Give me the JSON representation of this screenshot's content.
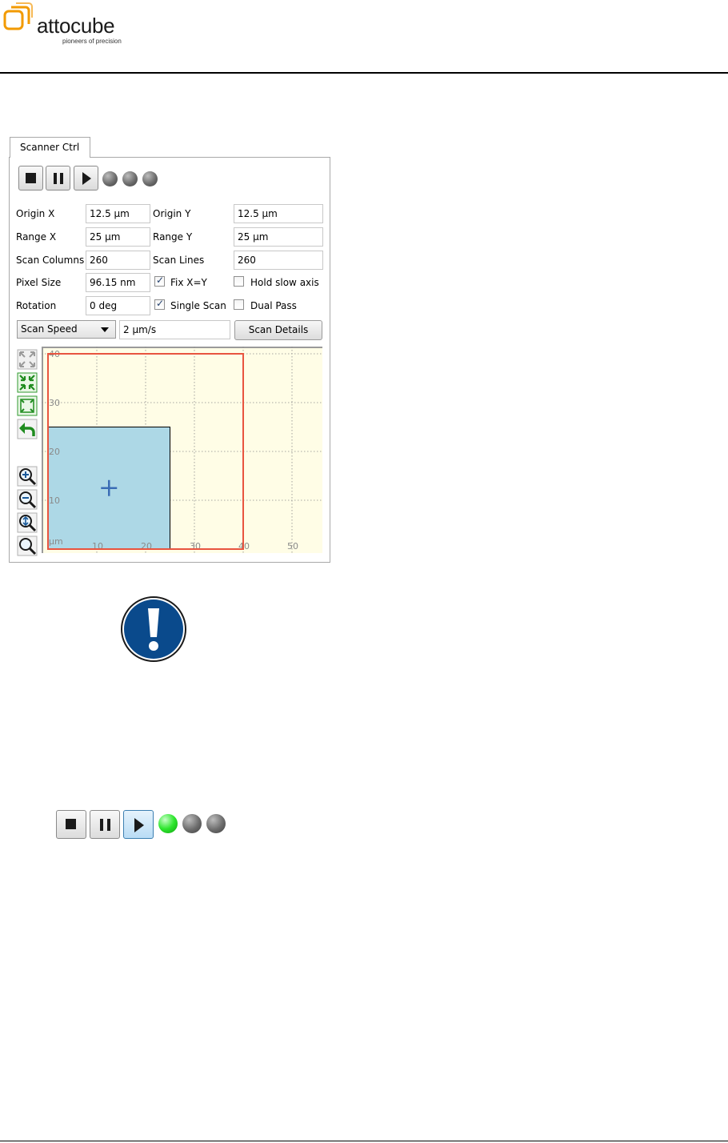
{
  "header": {
    "brand": "attocube",
    "tagline": "pioneers of precision",
    "brand_color": "#f29a00"
  },
  "scanner_ctrl": {
    "tab_label": "Scanner Ctrl",
    "toolbar": {
      "buttons": [
        "stop",
        "pause",
        "play"
      ],
      "indicators": [
        "off",
        "off",
        "off"
      ]
    },
    "fields": {
      "origin_x": {
        "label": "Origin X",
        "value": "12.5 µm"
      },
      "origin_y": {
        "label": "Origin Y",
        "value": "12.5 µm"
      },
      "range_x": {
        "label": "Range X",
        "value": "25 µm"
      },
      "range_y": {
        "label": "Range Y",
        "value": "25 µm"
      },
      "scan_columns": {
        "label": "Scan Columns",
        "value": "260"
      },
      "scan_lines": {
        "label": "Scan Lines",
        "value": "260"
      },
      "pixel_size": {
        "label": "Pixel Size",
        "value": "96.15 nm"
      },
      "rotation": {
        "label": "Rotation",
        "value": "0 deg"
      }
    },
    "checkboxes": {
      "fix_xy": {
        "label": "Fix  X=Y",
        "checked": true
      },
      "hold_slow_axis": {
        "label": "Hold slow axis",
        "checked": false
      },
      "single_scan": {
        "label": "Single Scan",
        "checked": true
      },
      "dual_pass": {
        "label": "Dual Pass",
        "checked": false
      }
    },
    "speed_select": {
      "selected": "Scan Speed",
      "value": "2 µm/s"
    },
    "scan_details_label": "Scan Details",
    "side_tools": [
      "fit-all-icon",
      "shrink-icon",
      "expand-icon",
      "undo-icon",
      "zoom-in-icon",
      "zoom-out-icon",
      "zoom-fit-icon",
      "zoom-icon"
    ]
  },
  "chart_data": {
    "type": "scatter",
    "title": "",
    "xlabel": "µm",
    "ylabel": "",
    "unit_label": "µm",
    "xlim": [
      0,
      55
    ],
    "ylim": [
      0,
      40
    ],
    "xticks": [
      10,
      20,
      30,
      40,
      50
    ],
    "yticks": [
      10,
      20,
      30,
      40
    ],
    "grid": true,
    "background": "#fffde6",
    "scan_area": {
      "x": [
        0,
        25
      ],
      "y": [
        0,
        25
      ],
      "color": "#add8e6",
      "center": [
        12.5,
        12.5
      ]
    },
    "limit_area": {
      "x": [
        0,
        40
      ],
      "y": [
        0,
        40
      ],
      "color": "#e8543f"
    }
  },
  "inline_toolbar": {
    "buttons": [
      "stop",
      "pause",
      "play"
    ],
    "active_button": "play",
    "indicators": [
      "on",
      "off",
      "off"
    ],
    "on_color": "#2ee62e"
  }
}
